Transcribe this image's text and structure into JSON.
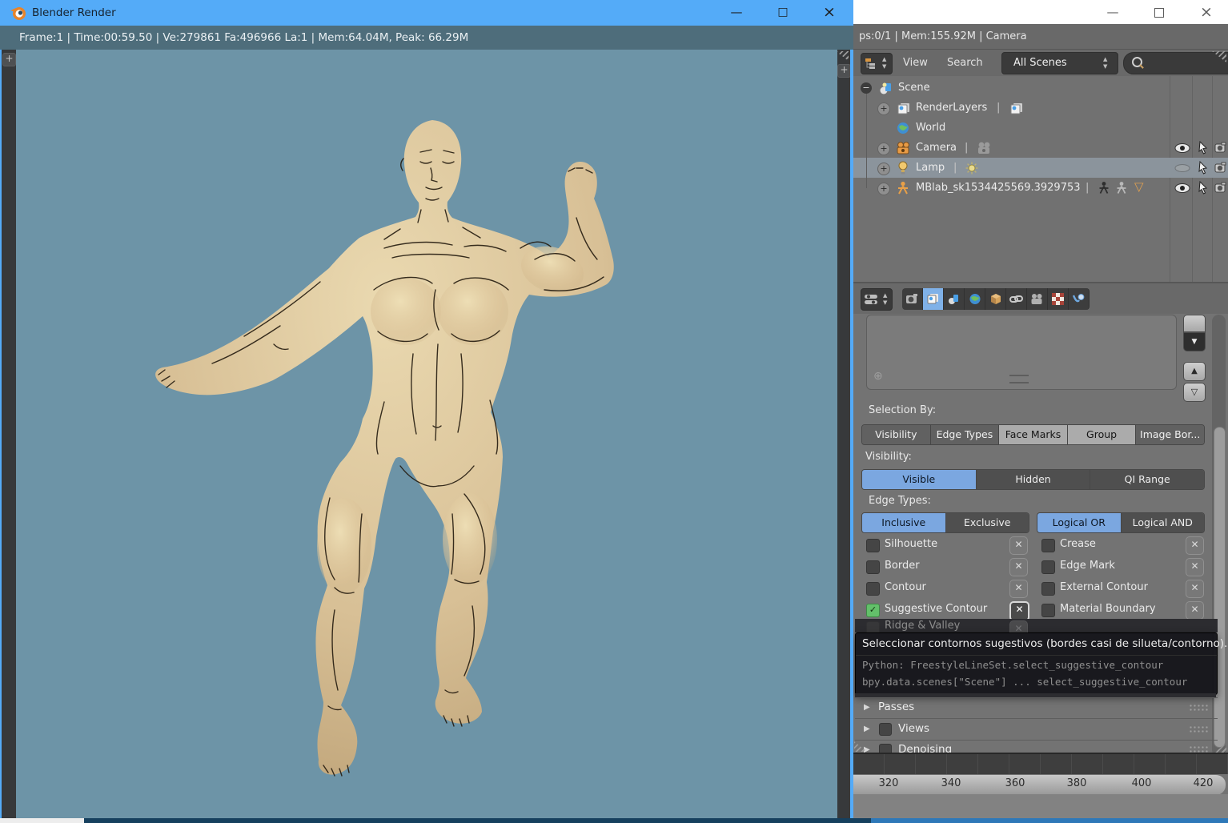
{
  "icons": {
    "minimize": "—",
    "maximize": "□",
    "close": "×",
    "plus": "+",
    "circle_plus": "⊕",
    "check": "✓",
    "x": "✕",
    "tri_down": "▼",
    "tri_up": "▲",
    "tri_down_open": "▽",
    "tri_right": "▶",
    "expand_minus": "−",
    "expand_plus": "+",
    "pipe": "|",
    "mesh_tri": "▽"
  },
  "front_window": {
    "title": "Blender Render",
    "stats": "Frame:1 | Time:00:59.50 | Ve:279861 Fa:496966 La:1 | Mem:64.04M, Peak: 66.29M"
  },
  "back_window": {
    "infobar": "ps:0/1 | Mem:155.92M | Camera",
    "outliner": {
      "view_label": "View",
      "search_label": "Search",
      "filter_value": "All Scenes",
      "rows": [
        {
          "label": "Scene"
        },
        {
          "label": "RenderLayers"
        },
        {
          "label": "World"
        },
        {
          "label": "Camera"
        },
        {
          "label": "Lamp"
        },
        {
          "label": "MBlab_sk1534425569.3929753"
        }
      ]
    },
    "properties": {
      "selection_by_label": "Selection By:",
      "selection_by": [
        {
          "label": "Visibility",
          "on": false
        },
        {
          "label": "Edge Types",
          "on": false
        },
        {
          "label": "Face Marks",
          "on": true
        },
        {
          "label": "Group",
          "on": true
        },
        {
          "label": "Image Bor...",
          "on": false
        }
      ],
      "visibility_label": "Visibility:",
      "visibility": [
        {
          "label": "Visible",
          "active": true
        },
        {
          "label": "Hidden",
          "active": false
        },
        {
          "label": "QI Range",
          "active": false
        }
      ],
      "edge_types_label": "Edge Types:",
      "edge_mode": [
        {
          "label": "Inclusive",
          "active": true
        },
        {
          "label": "Exclusive",
          "active": false
        },
        {
          "label": "Logical OR",
          "active": true
        },
        {
          "label": "Logical AND",
          "active": false
        }
      ],
      "edge_left": [
        {
          "label": "Silhouette",
          "checked": false
        },
        {
          "label": "Border",
          "checked": false
        },
        {
          "label": "Contour",
          "checked": false
        },
        {
          "label": "Suggestive Contour",
          "checked": true
        }
      ],
      "edge_right": [
        {
          "label": "Crease",
          "checked": false
        },
        {
          "label": "Edge Mark",
          "checked": false
        },
        {
          "label": "External Contour",
          "checked": false
        },
        {
          "label": "Material Boundary",
          "checked": false
        }
      ],
      "partial_row_label": "Ridge & Valley",
      "panels": [
        {
          "label": "Passes"
        },
        {
          "label": "Views"
        },
        {
          "label": "Denoising"
        }
      ]
    },
    "tooltip": {
      "text": "Seleccionar contornos sugestivos (bordes casi de silueta/contorno).",
      "python_line1": "Python: FreestyleLineSet.select_suggestive_contour",
      "python_line2": "bpy.data.scenes[\"Scene\"] ... select_suggestive_contour"
    },
    "timeline": {
      "ticks": [
        "320",
        "340",
        "360",
        "380",
        "400",
        "420"
      ]
    }
  }
}
